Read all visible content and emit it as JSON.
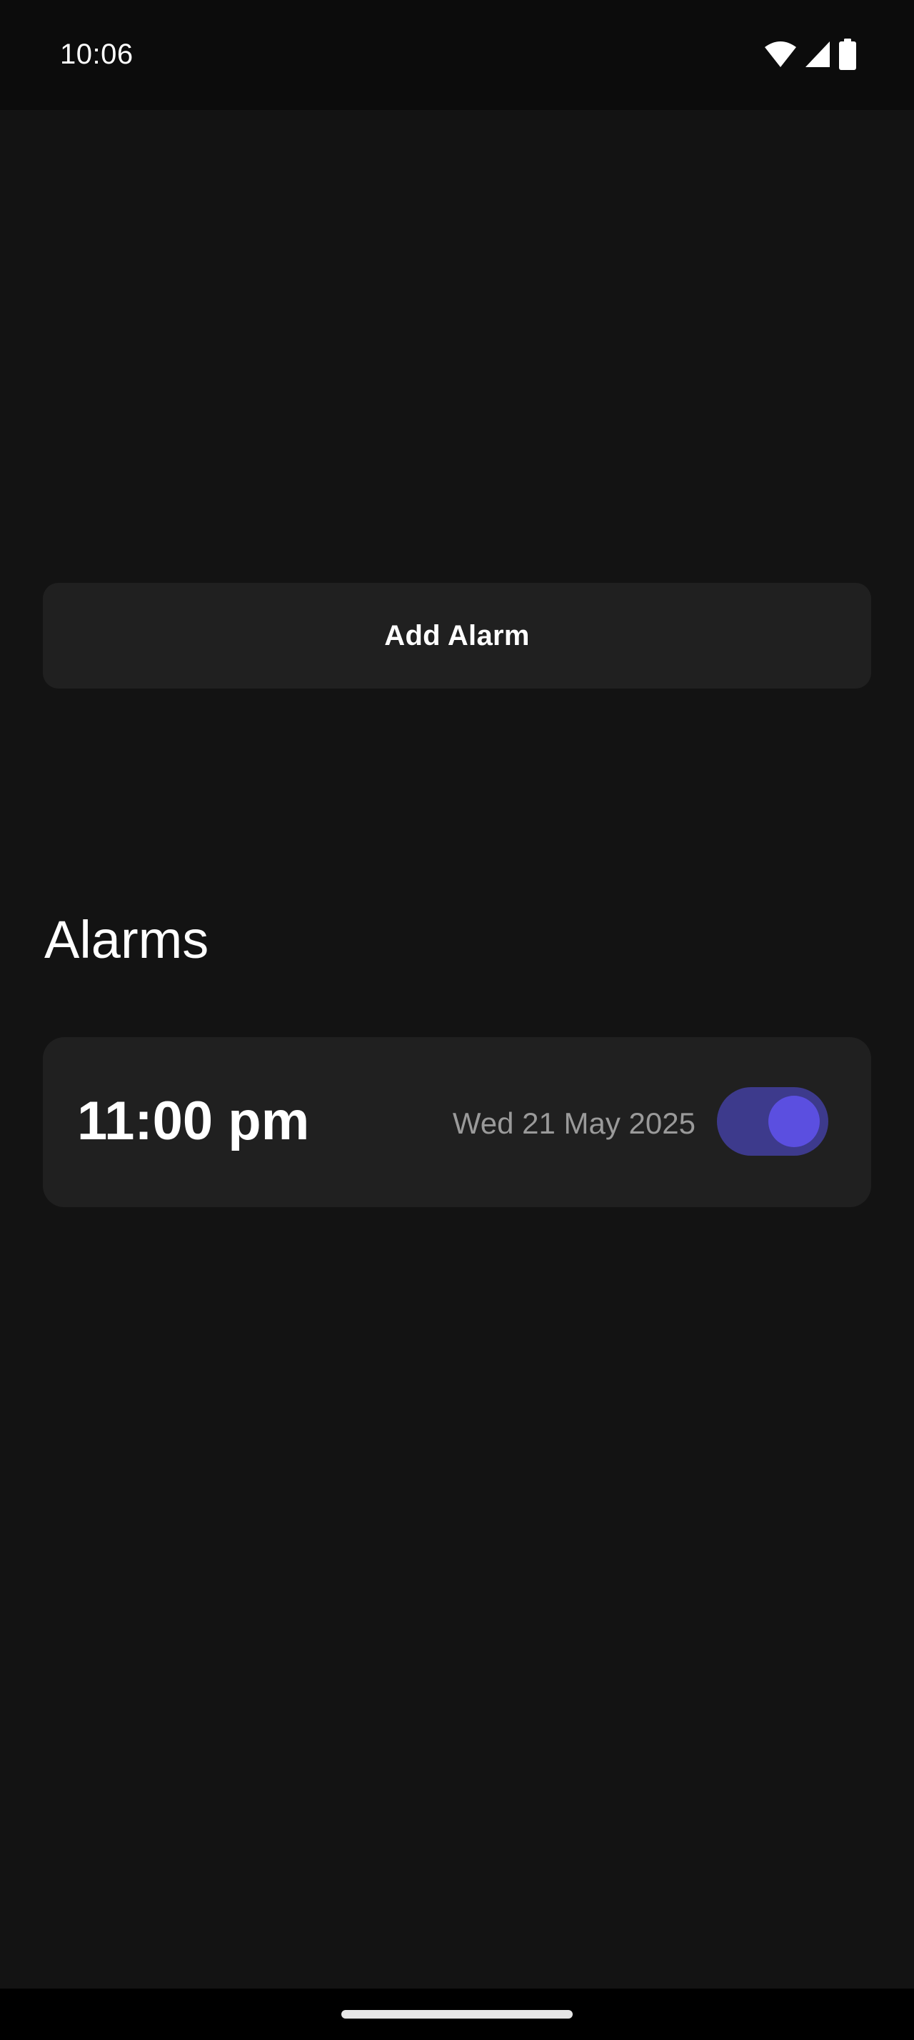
{
  "status_bar": {
    "time": "10:06",
    "icons": [
      "wifi-icon",
      "signal-icon",
      "battery-icon"
    ]
  },
  "actions": {
    "add_alarm_label": "Add Alarm"
  },
  "alarms_section": {
    "title": "Alarms",
    "items": [
      {
        "time": "11:00 pm",
        "date": "Wed 21 May 2025",
        "enabled": true
      }
    ]
  },
  "colors": {
    "background": "#131313",
    "surface": "#202020",
    "toggle_track": "#3d3a8c",
    "toggle_knob": "#5b4fe0",
    "secondary_text": "#9a9a9a"
  }
}
